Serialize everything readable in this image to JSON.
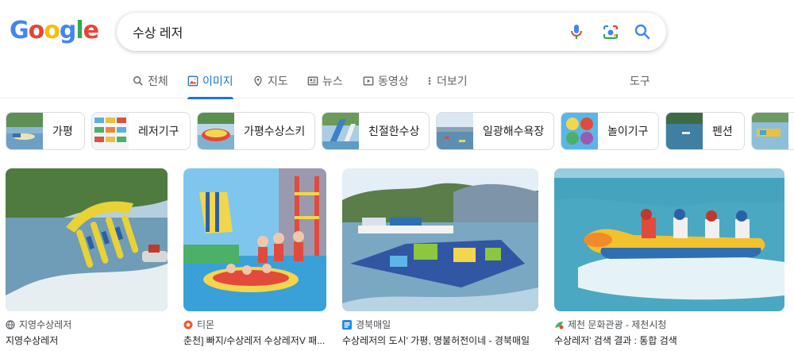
{
  "logo": {
    "letters": [
      "G",
      "o",
      "o",
      "g",
      "l",
      "e"
    ]
  },
  "search": {
    "query": "수상 레저"
  },
  "tabs": [
    {
      "label": "전체"
    },
    {
      "label": "이미지"
    },
    {
      "label": "지도"
    },
    {
      "label": "뉴스"
    },
    {
      "label": "동영상"
    },
    {
      "label": "더보기"
    }
  ],
  "tools_label": "도구",
  "chips": [
    {
      "label": "가평"
    },
    {
      "label": "레저기구"
    },
    {
      "label": "가평수상스키"
    },
    {
      "label": "친절한수상"
    },
    {
      "label": "일광해수욕장"
    },
    {
      "label": "놀이기구"
    },
    {
      "label": "펜션"
    }
  ],
  "results": [
    {
      "source": "지영수상레저",
      "caption": "지영수상레저"
    },
    {
      "source": "티몬",
      "caption": "춘천] 빠지/수상레저 수상레저V 패..."
    },
    {
      "source": "경북매일",
      "caption": "수상레저의 도시' 가평, 명불허전이네 - 경북매일"
    },
    {
      "source": "제천 문화관광 - 제천시청",
      "caption": "수상레저' 검색 결과 : 통합 검색"
    }
  ],
  "colors": {
    "accent": "#1a73e8",
    "text_secondary": "#5f6368"
  }
}
